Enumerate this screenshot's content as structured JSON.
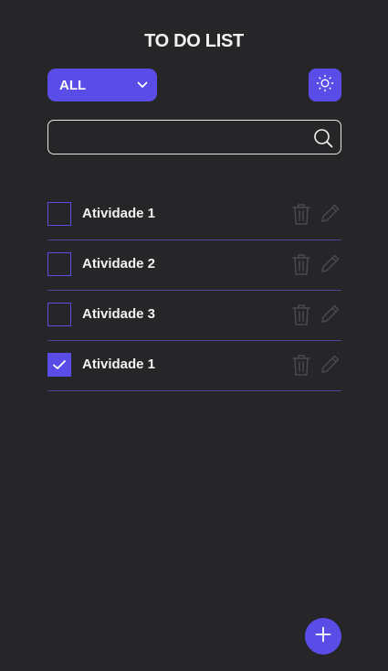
{
  "app": {
    "title": "TO DO LIST"
  },
  "filter": {
    "selected": "ALL"
  },
  "search": {
    "value": "",
    "placeholder": ""
  },
  "todos": [
    {
      "label": "Atividade 1",
      "checked": false
    },
    {
      "label": "Atividade 2",
      "checked": false
    },
    {
      "label": "Atividade 3",
      "checked": false
    },
    {
      "label": "Atividade 1",
      "checked": true
    }
  ],
  "icons": {
    "theme": "sun-icon",
    "search": "search-icon",
    "delete": "trash-icon",
    "edit": "pencil-icon",
    "add": "plus-icon",
    "dropdown": "chevron-down-icon",
    "check": "check-icon"
  },
  "colors": {
    "accent": "#5a4ce6",
    "background": "#262628",
    "divider": "#4d4599",
    "muted_icon": "#4a4a4e"
  }
}
